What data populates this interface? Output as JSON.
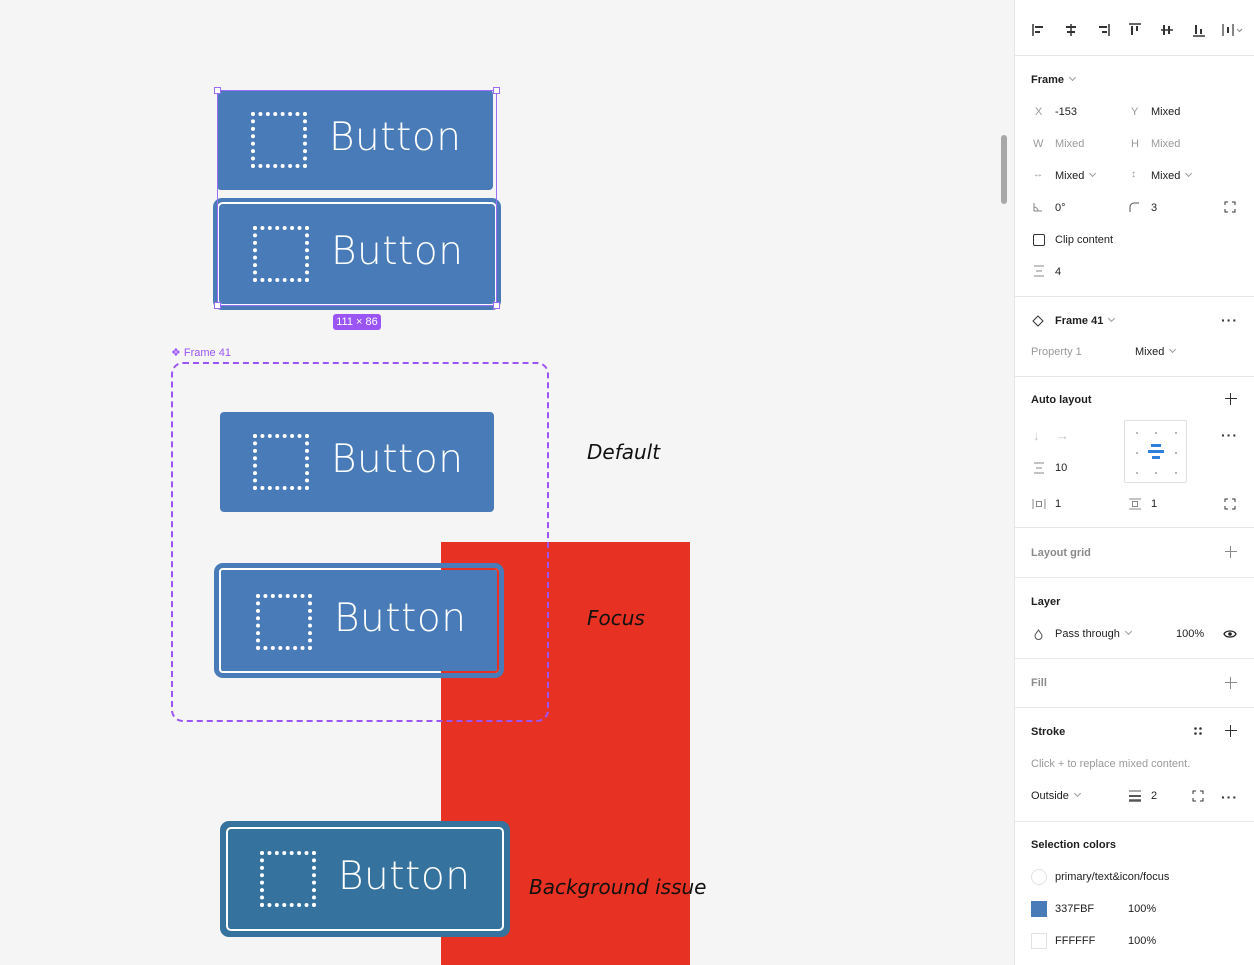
{
  "canvas": {
    "top_buttons": [
      {
        "label": "Button",
        "state": "selected"
      },
      {
        "label": "Button",
        "state": "selected-focus"
      }
    ],
    "selection_size_badge": "111 × 86",
    "frame": {
      "name": "Frame 41",
      "buttons": [
        {
          "label": "Button",
          "state": "default"
        },
        {
          "label": "Button",
          "state": "focus"
        }
      ]
    },
    "bottom_button": {
      "label": "Button"
    },
    "annotations": {
      "default": "Default",
      "focus": "Focus",
      "background_issue": "Background issue"
    },
    "colors": {
      "button_fill": "#487BB7",
      "bottom_button_fill": "#35739E",
      "red_block": "#E73122",
      "selection": "#9B55F5"
    }
  },
  "panel": {
    "align_tools": [
      "align-left",
      "align-horizontal-center",
      "align-right",
      "align-top",
      "align-vertical-center",
      "align-bottom",
      "distribute"
    ],
    "frame": {
      "title": "Frame",
      "x_label": "X",
      "x_value": "-153",
      "y_label": "Y",
      "y_value": "Mixed",
      "w_label": "W",
      "w_value": "Mixed",
      "h_label": "H",
      "h_value": "Mixed",
      "h_resizing": "Mixed",
      "v_resizing": "Mixed",
      "rotation": "0°",
      "corner_radius": "3",
      "clip_content_label": "Clip content",
      "clip_content_checked": false,
      "spacing": "4"
    },
    "component": {
      "name": "Frame 41",
      "property_label": "Property 1",
      "property_value": "Mixed"
    },
    "auto_layout": {
      "title": "Auto layout",
      "gap": "10",
      "h_padding": "1",
      "v_padding": "1"
    },
    "layout_grid": {
      "title": "Layout grid"
    },
    "layer": {
      "title": "Layer",
      "blend_mode": "Pass through",
      "opacity": "100%"
    },
    "fill": {
      "title": "Fill"
    },
    "stroke": {
      "title": "Stroke",
      "hint": "Click + to replace mixed content.",
      "position": "Outside",
      "weight": "2"
    },
    "selection_colors": {
      "title": "Selection colors",
      "items": [
        {
          "name": "primary/text&icon/focus",
          "swatch": "#FFFFFF",
          "opacity": ""
        },
        {
          "name": "337FBF",
          "swatch": "#487BB7",
          "opacity": "100%"
        },
        {
          "name": "FFFFFF",
          "swatch": "#FFFFFF",
          "opacity": "100%"
        }
      ]
    }
  }
}
